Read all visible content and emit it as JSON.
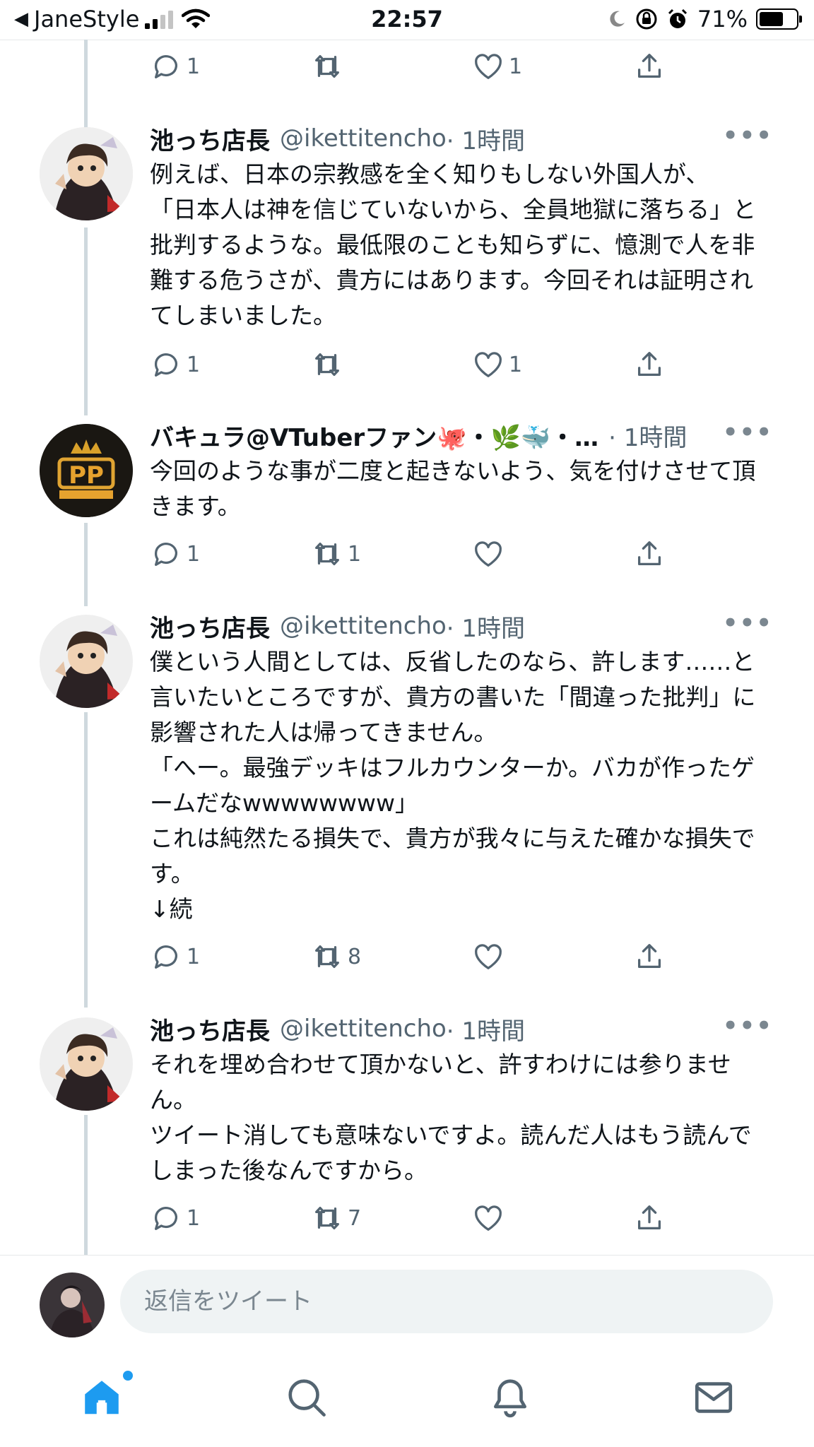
{
  "status_bar": {
    "carrier": "JaneStyle",
    "time": "22:57",
    "battery": "71%",
    "battery_level": 0.71
  },
  "colors": {
    "accent": "#1d9bf0",
    "text_primary": "#0f1419",
    "text_secondary": "#536471",
    "thread_line": "#cfd9de"
  },
  "top_actions": {
    "reply_count": "1",
    "retweet_count": "",
    "like_count": "1"
  },
  "tweets": [
    {
      "name": "池っち店長",
      "handle": "@ikettitencho",
      "time": "· 1時間",
      "body": "例えば、日本の宗教感を全く知りもしない外国人が、\n「日本人は神を信じていないから、全員地獄に落ちる」と批判するような。最低限のことも知らずに、憶測で人を非難する危うさが、貴方にはあります。今回それは証明されてしまいました。",
      "reply_count": "1",
      "retweet_count": "",
      "like_count": "1"
    },
    {
      "name": "バキュラ@VTuberファン🐙・🌿🐳・…",
      "handle": "",
      "time": "· 1時間",
      "body": "今回のような事が二度と起きないよう、気を付けさせて頂きます。",
      "reply_count": "1",
      "retweet_count": "1",
      "like_count": ""
    },
    {
      "name": "池っち店長",
      "handle": "@ikettitencho",
      "time": "· 1時間",
      "body": "僕という人間としては、反省したのなら、許します……と言いたいところですが、貴方の書いた「間違った批判」に影響された人は帰ってきません。\n「へー。最強デッキはフルカウンターか。バカが作ったゲームだなwwwwwwww」\nこれは純然たる損失で、貴方が我々に与えた確かな損失です。\n↓続",
      "reply_count": "1",
      "retweet_count": "8",
      "like_count": ""
    },
    {
      "name": "池っち店長",
      "handle": "@ikettitencho",
      "time": "· 1時間",
      "body": "それを埋め合わせて頂かないと、許すわけには参りません。\nツイート消しても意味ないですよ。読んだ人はもう読んでしまった後なんですから。",
      "reply_count": "1",
      "retweet_count": "7",
      "like_count": ""
    }
  ],
  "reply_bar": {
    "placeholder": "返信をツイート"
  },
  "tab_bar": {
    "items": [
      {
        "icon": "home-icon",
        "active": true
      },
      {
        "icon": "search-icon",
        "active": false
      },
      {
        "icon": "bell-icon",
        "active": false
      },
      {
        "icon": "mail-icon",
        "active": false
      }
    ]
  }
}
